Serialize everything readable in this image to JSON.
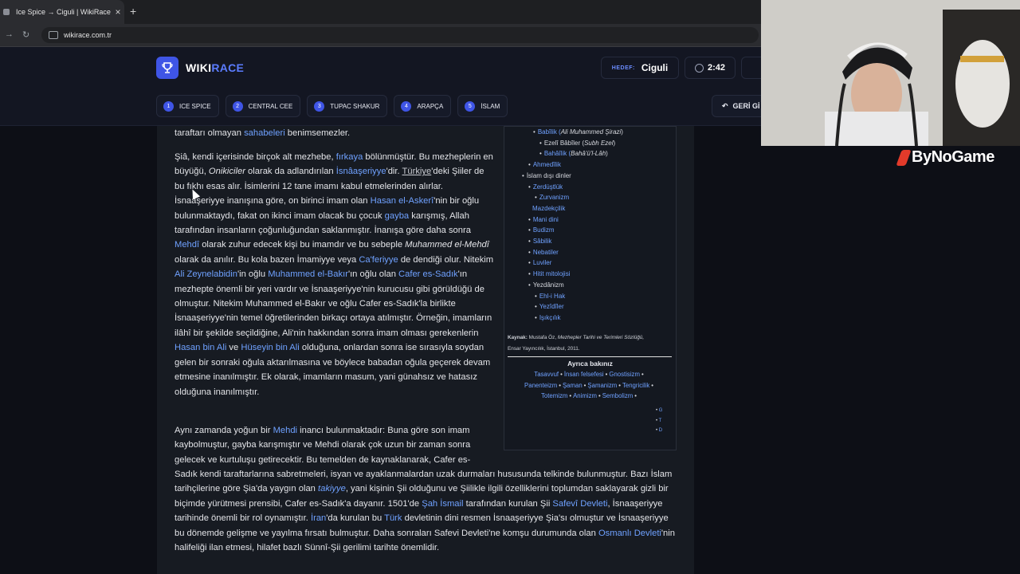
{
  "browser": {
    "tab_title": "Ice Spice → Ciguli | WikiRace",
    "tab_close": "×",
    "new_tab": "+",
    "url": "wikirace.com.tr"
  },
  "header": {
    "logo_wiki": "WIKI",
    "logo_race": "RACE",
    "target_label": "HEDEF:",
    "target_value": "Ciguli",
    "timer": "2:42",
    "back_label": "GERİ Gİ"
  },
  "steps": [
    {
      "num": "1",
      "label": "ICE SPICE"
    },
    {
      "num": "2",
      "label": "CENTRAL CEE"
    },
    {
      "num": "3",
      "label": "TUPAC SHAKUR"
    },
    {
      "num": "4",
      "label": "ARAPÇA"
    },
    {
      "num": "5",
      "label": "İSLAM"
    }
  ],
  "article": {
    "p0": {
      "t1": "taraftarı olmayan ",
      "l1": "sahabeleri",
      "t2": " benimsemezler."
    },
    "p1": {
      "t1": "Şiâ, kendi içerisinde birçok alt mezhebe, ",
      "l1": "fırkaya",
      "t2": " bölünmüştür. Bu mezheplerin en büyüğü, ",
      "i1": "Onikiciler",
      "t3": " olarak da adlandırılan ",
      "l2": "İsnâaşeriyye",
      "t4": "'dir. ",
      "l3": "Türkiye",
      "t5": "'deki Şiiler de bu fıkhı esas alır. İsimlerini 12 tane imamı kabul etmelerinden alırlar. İsnaaşeriyye inanışına göre, on birinci imam olan ",
      "l4": "Hasan el-Askerî",
      "t6": "'nin bir oğlu bulunmaktaydı, fakat on ikinci imam olacak bu çocuk ",
      "l5": "gayba",
      "t7": " karışmış, Allah tarafından insanların çoğunluğundan saklanmıştır. İnanışa göre daha sonra ",
      "l6": "Mehdî",
      "t8": " olarak zuhur edecek kişi bu imamdır ve bu sebeple ",
      "i2": "Muhammed el-Mehdî",
      "t9": " olarak da anılır. Bu kola bazen İmamiyye veya ",
      "l7": "Ca'feriyye",
      "t10": " de dendiği olur. Nitekim ",
      "l8": "Ali Zeynelabidin",
      "t11": "'in oğlu ",
      "l9": "Muhammed el-Bakır",
      "t12": "'ın oğlu olan ",
      "l10": "Cafer es-Sadık",
      "t13": "'ın mezhepte önemli bir yeri vardır ve İsnaaşeriyye'nin kurucusu gibi görüldüğü de olmuştur. Nitekim Muhammed el-Bakır ve oğlu Cafer es-Sadık'la birlikte İsnaaşeriyye'nin temel öğretilerinden birkaçı ortaya atılmıştır. Örneğin, imamların ilâhî bir şekilde seçildiğine, Ali'nin hakkından sonra imam olması gerekenlerin ",
      "l11": "Hasan bin Ali",
      "t14": " ve ",
      "l12": "Hüseyin bin Ali",
      "t15": " olduğuna, onlardan sonra ise sırasıyla soydan gelen bir sonraki oğula aktarılmasına ve böylece babadan oğula geçerek devam etmesine inanılmıştır. Ek olarak, imamların masum, yani günahsız ve hatasız olduğuna inanılmıştır."
    },
    "p2a": {
      "t1": "Aynı zamanda yoğun bir ",
      "l1": "Mehdi",
      "t2": " inancı bulunmaktadır: Buna göre son imam kaybolmuştur, gayba karışmıştır ve Mehdi olarak çok uzun bir zaman sonra gelecek ve kurtuluşu getirecektir. Bu temelden de kaynaklanarak, Cafer es-"
    },
    "p2b": {
      "t1": "Sadık kendi taraftarlarına sabretmeleri, isyan ve ayaklanmalardan uzak durmaları hususunda telkinde bulunmuştur. Bazı İslam tarihçilerine göre Şia'da yaygın olan ",
      "l1": "takiyye",
      "t2": ", yani kişinin Şii olduğunu ve Şiilikle ilgili özelliklerini toplumdan saklayarak gizli bir biçimde yürütmesi prensibi, Cafer es-Sadık'a dayanır. 1501'de ",
      "l2": "Şah İsmail",
      "t3": " tarafından kurulan Şii ",
      "l3": "Safevî Devleti",
      "t4": ", İsnaaşeriyye tarihinde önemli bir rol oynamıştır. ",
      "l4": "İran",
      "t5": "'da kurulan bu ",
      "l5": "Türk",
      "t6": " devletinin dini resmen İsnaaşeriyye Şia'sı olmuştur ve İsnaaşeriyye bu dönemde gelişme ve yayılma fırsatı bulmuştur. Daha sonraları Safevi Devleti'ne komşu durumunda olan ",
      "l6": "Osmanlı Devleti",
      "t7": "'nin halifeliği ilan etmesi, hilafet bazlı Sünnî-Şii gerilimi tarihte önemlidir."
    }
  },
  "infobox": {
    "items": [
      {
        "bullet": "•",
        "text": "Babîlik (",
        "italic": "Ali Muhammed Şirazi",
        "end": ")",
        "link": true
      },
      {
        "bullet": "•",
        "text": "Ezelî Bâbîler (",
        "italic": "Subh Ezel",
        "end": ")",
        "link": false
      },
      {
        "bullet": "•",
        "text": "Bahâîlik (",
        "italic": "Bahâ'ü'l-Lâh",
        "end": ")",
        "link": true
      },
      {
        "bullet": "•",
        "text": "Ahmedîlik",
        "italic": "",
        "end": "",
        "link": true
      },
      {
        "bullet": "•",
        "text": "İslam dışı dinler",
        "italic": "",
        "end": "",
        "link": false
      },
      {
        "bullet": "•",
        "text": "Zerdüştlük",
        "italic": "",
        "end": "",
        "link": true
      },
      {
        "bullet": "•",
        "text": "Zurvanizm",
        "italic": "",
        "end": "",
        "link": true
      },
      {
        "bullet": "",
        "text": "Mazdekçilik",
        "italic": "",
        "end": "",
        "link": true
      },
      {
        "bullet": "•",
        "text": "Mani dini",
        "italic": "",
        "end": "",
        "link": true
      },
      {
        "bullet": "•",
        "text": "Budizm",
        "italic": "",
        "end": "",
        "link": true
      },
      {
        "bullet": "•",
        "text": "Sâbilik",
        "italic": "",
        "end": "",
        "link": true
      },
      {
        "bullet": "•",
        "text": "Nebatiler",
        "italic": "",
        "end": "",
        "link": true
      },
      {
        "bullet": "•",
        "text": "Luviler",
        "italic": "",
        "end": "",
        "link": true
      },
      {
        "bullet": "•",
        "text": "Hitit mitolojisi",
        "italic": "",
        "end": "",
        "link": true
      },
      {
        "bullet": "•",
        "text": "Yezdânizm",
        "italic": "",
        "end": "",
        "link": false
      },
      {
        "bullet": "•",
        "text": "Ehl-i Hak",
        "italic": "",
        "end": "",
        "link": true
      },
      {
        "bullet": "•",
        "text": "Yezîdîler",
        "italic": "",
        "end": "",
        "link": true
      },
      {
        "bullet": "•",
        "text": "Işıkçılık",
        "italic": "",
        "end": "",
        "link": true
      }
    ],
    "source_label": "Kaynak:",
    "source_text": " Mustafa Öz, ",
    "source_italic": "Mezhepler Tarihi ve Terimleri Sözlüğü,",
    "source_line2": "Ensar Yayıncılık, İstanbul, 2011.",
    "see_also_title": "Ayrıca bakınız",
    "see_also": [
      "Tasavvuf",
      "İnsan felsefesi",
      "Gnostisizm",
      "Panenteizm",
      "Şaman",
      "Şamanizm",
      "Tengricilik",
      "Totemizm",
      "Animizm",
      "Sembolizm"
    ],
    "vtd": [
      "G",
      "T",
      "D"
    ]
  },
  "overlay": {
    "brand": "ByNoGame"
  }
}
